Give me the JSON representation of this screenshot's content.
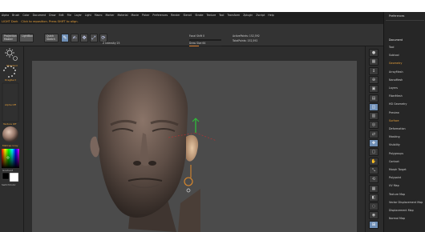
{
  "menu": [
    "Alpha",
    "Brush",
    "Color",
    "Document",
    "Draw",
    "Edit",
    "File",
    "Layer",
    "Light",
    "Macro",
    "Marker",
    "Material",
    "Movie",
    "Picker",
    "Preferences",
    "Render",
    "Stencil",
    "Stroke",
    "Texture",
    "Tool",
    "Transform",
    "Zplugin",
    "Zscript",
    "Help"
  ],
  "hint_bar": {
    "label": "LIGHT Dark",
    "message": "Click to reposition. Press SHIFT to align."
  },
  "toolbar": {
    "buttons": [
      "Projection Master",
      "LightBox",
      "Quick Sketch"
    ],
    "mode_icons": [
      {
        "name": "edit-icon",
        "glyph": "✎",
        "active": true
      },
      {
        "name": "draw-icon",
        "glyph": "✍",
        "active": false
      },
      {
        "name": "move-icon",
        "glyph": "✥",
        "active": false
      },
      {
        "name": "scale-icon",
        "glyph": "⤢",
        "active": false
      },
      {
        "name": "rotate-icon",
        "glyph": "⟳",
        "active": false
      }
    ],
    "focal_shift_label": "Focal Shift 0",
    "draw_size_label": "Draw Size 64",
    "z_intensity_label": "Z Intensity 25",
    "active_points_label": "ActivePoints: 152,592",
    "total_points_label": "TotalPoints: 152,592"
  },
  "left_shelf": {
    "brush_label": "Standard",
    "stroke_label": "DragRect",
    "alpha_label": "Alpha Off",
    "texture_label": "Texture Off",
    "material_label": "MatCap Gray",
    "gradient_label": "Gradient",
    "switch_label": "SwitchColor"
  },
  "right_shelf": {
    "buttons": [
      {
        "name": "bpr-button",
        "glyph": "●",
        "active": false
      },
      {
        "name": "spix-button",
        "glyph": "▦",
        "active": false
      },
      {
        "name": "scroll-button",
        "glyph": "↕",
        "active": false
      },
      {
        "name": "zoom-button",
        "glyph": "⊕",
        "active": false
      },
      {
        "name": "actual-button",
        "glyph": "▣",
        "active": false
      },
      {
        "name": "aahalf-button",
        "glyph": "▤",
        "active": false
      },
      {
        "name": "persp-button",
        "glyph": "◫",
        "active": true
      },
      {
        "name": "floor-button",
        "glyph": "▥",
        "active": false
      },
      {
        "name": "local-button",
        "glyph": "◎",
        "active": false
      },
      {
        "name": "lsym-button",
        "glyph": "⇄",
        "active": false
      },
      {
        "name": "xyz-button",
        "glyph": "✥",
        "active": true
      },
      {
        "name": "frame-button",
        "glyph": "▢",
        "active": false
      },
      {
        "name": "move-view-button",
        "glyph": "✋",
        "active": false
      },
      {
        "name": "scale-view-button",
        "glyph": "⤡",
        "active": false
      },
      {
        "name": "rotate-view-button",
        "glyph": "⟲",
        "active": false
      },
      {
        "name": "polyf-button",
        "glyph": "▦",
        "active": false
      },
      {
        "name": "transp-button",
        "glyph": "◧",
        "active": false
      },
      {
        "name": "ghost-button",
        "glyph": "◌",
        "active": false
      },
      {
        "name": "solo-button",
        "glyph": "◉",
        "active": false
      },
      {
        "name": "xpose-button",
        "glyph": "⊞",
        "active": true
      }
    ]
  },
  "tray": {
    "header": "Preferences",
    "section": "Document",
    "items": [
      {
        "label": "Tool",
        "hl": false
      },
      {
        "label": "Subtool",
        "hl": false
      },
      {
        "label": "Geometry",
        "hl": true
      },
      {
        "label": "ArrayMesh",
        "hl": false
      },
      {
        "label": "NanoMesh",
        "hl": false
      },
      {
        "label": "Layers",
        "hl": false
      },
      {
        "label": "FiberMesh",
        "hl": false
      },
      {
        "label": "HD Geometry",
        "hl": false
      },
      {
        "label": "Preview",
        "hl": false
      },
      {
        "label": "Surface",
        "hl": true
      },
      {
        "label": "Deformation",
        "hl": false
      },
      {
        "label": "Masking",
        "hl": false
      },
      {
        "label": "Visibility",
        "hl": false
      },
      {
        "label": "Polygroups",
        "hl": false
      },
      {
        "label": "Contact",
        "hl": false
      },
      {
        "label": "Morph Target",
        "hl": false
      },
      {
        "label": "Polypaint",
        "hl": false
      },
      {
        "label": "UV Map",
        "hl": false
      },
      {
        "label": "Texture Map",
        "hl": false
      },
      {
        "label": "Vector Displacement Map",
        "hl": false
      },
      {
        "label": "Displacement Map",
        "hl": false
      },
      {
        "label": "Normal Map",
        "hl": false
      }
    ]
  },
  "colors": {
    "accent": "#d77a2a",
    "active_button": "#6f8fb6",
    "canvas": "#4b4b4b",
    "skin": "#6a5a52"
  }
}
